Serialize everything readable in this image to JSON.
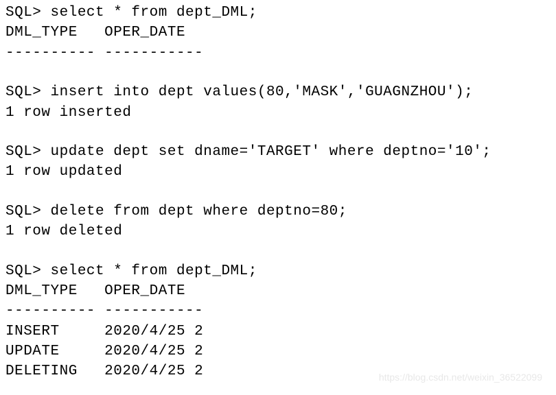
{
  "lines": {
    "l1": "SQL> select * from dept_DML;",
    "l2": "DML_TYPE   OPER_DATE",
    "l3": "---------- -----------",
    "l4": "SQL> insert into dept values(80,'MASK','GUAGNZHOU');",
    "l5": "1 row inserted",
    "l6": "SQL> update dept set dname='TARGET' where deptno='10';",
    "l7": "1 row updated",
    "l8": "SQL> delete from dept where deptno=80;",
    "l9": "1 row deleted",
    "l10": "SQL> select * from dept_DML;",
    "l11": "DML_TYPE   OPER_DATE",
    "l12": "---------- -----------",
    "l13": "INSERT     2020/4/25 2",
    "l14": "UPDATE     2020/4/25 2",
    "l15": "DELETING   2020/4/25 2"
  },
  "watermark": "https://blog.csdn.net/weixin_36522099",
  "chart_data": {
    "type": "table",
    "title": "dept_DML query result",
    "columns": [
      "DML_TYPE",
      "OPER_DATE"
    ],
    "rows": [
      {
        "DML_TYPE": "INSERT",
        "OPER_DATE": "2020/4/25 2"
      },
      {
        "DML_TYPE": "UPDATE",
        "OPER_DATE": "2020/4/25 2"
      },
      {
        "DML_TYPE": "DELETING",
        "OPER_DATE": "2020/4/25 2"
      }
    ]
  }
}
